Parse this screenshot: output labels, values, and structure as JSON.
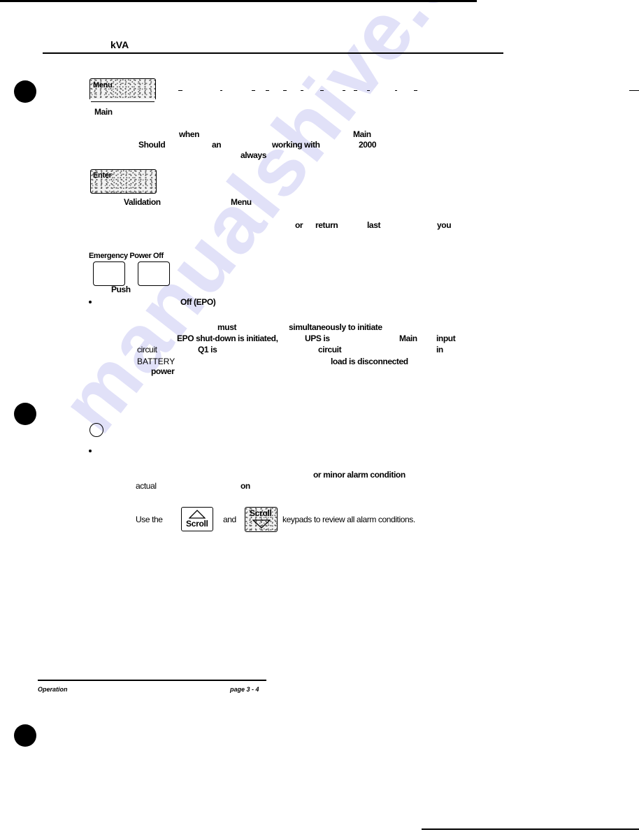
{
  "header": {
    "title_fragment": "kVA"
  },
  "menu_section": {
    "key_label": "Menu",
    "heading": "Main",
    "line1": {
      "when": "when",
      "main": "Main"
    },
    "line2": {
      "should": "Should",
      "an": "an",
      "working_with": "working with",
      "year": "2000"
    },
    "line3": {
      "always": "always"
    }
  },
  "enter_section": {
    "key_label": "Enter",
    "validation": "Validation",
    "menu": "Menu",
    "line2": {
      "or": "or",
      "return": "return",
      "last": "last",
      "you": "you"
    }
  },
  "epo_section": {
    "panel_label": "Emergency Power Off",
    "push_label": "Push",
    "bullet_text": "Off (EPO)",
    "lines": {
      "must": "must",
      "simultaneously": "simultaneously to initiate",
      "epo_shutdown": "EPO shut-down is initiated,",
      "ups_is": "UPS is",
      "main": "Main",
      "input": "input",
      "circuit1": "circuit",
      "q1_is": "Q1 is",
      "circuit2": "circuit",
      "in": "in",
      "battery": "BATTERY",
      "load_disconnected": "load is disconnected",
      "power": "power"
    }
  },
  "alarm_section": {
    "icon": "alarm-circle-icon",
    "lines": {
      "minor_alarm": "or minor alarm condition",
      "actual": "actual",
      "on": "on"
    },
    "instruction": {
      "use_the": "Use the",
      "scroll_up_label": "Scroll",
      "and": "and",
      "scroll_down_label": "Scroll",
      "rest": "keypads to review all alarm conditions."
    }
  },
  "footer": {
    "section": "Operation",
    "page": "page 3 - 4"
  },
  "watermark": "manualshive.com"
}
